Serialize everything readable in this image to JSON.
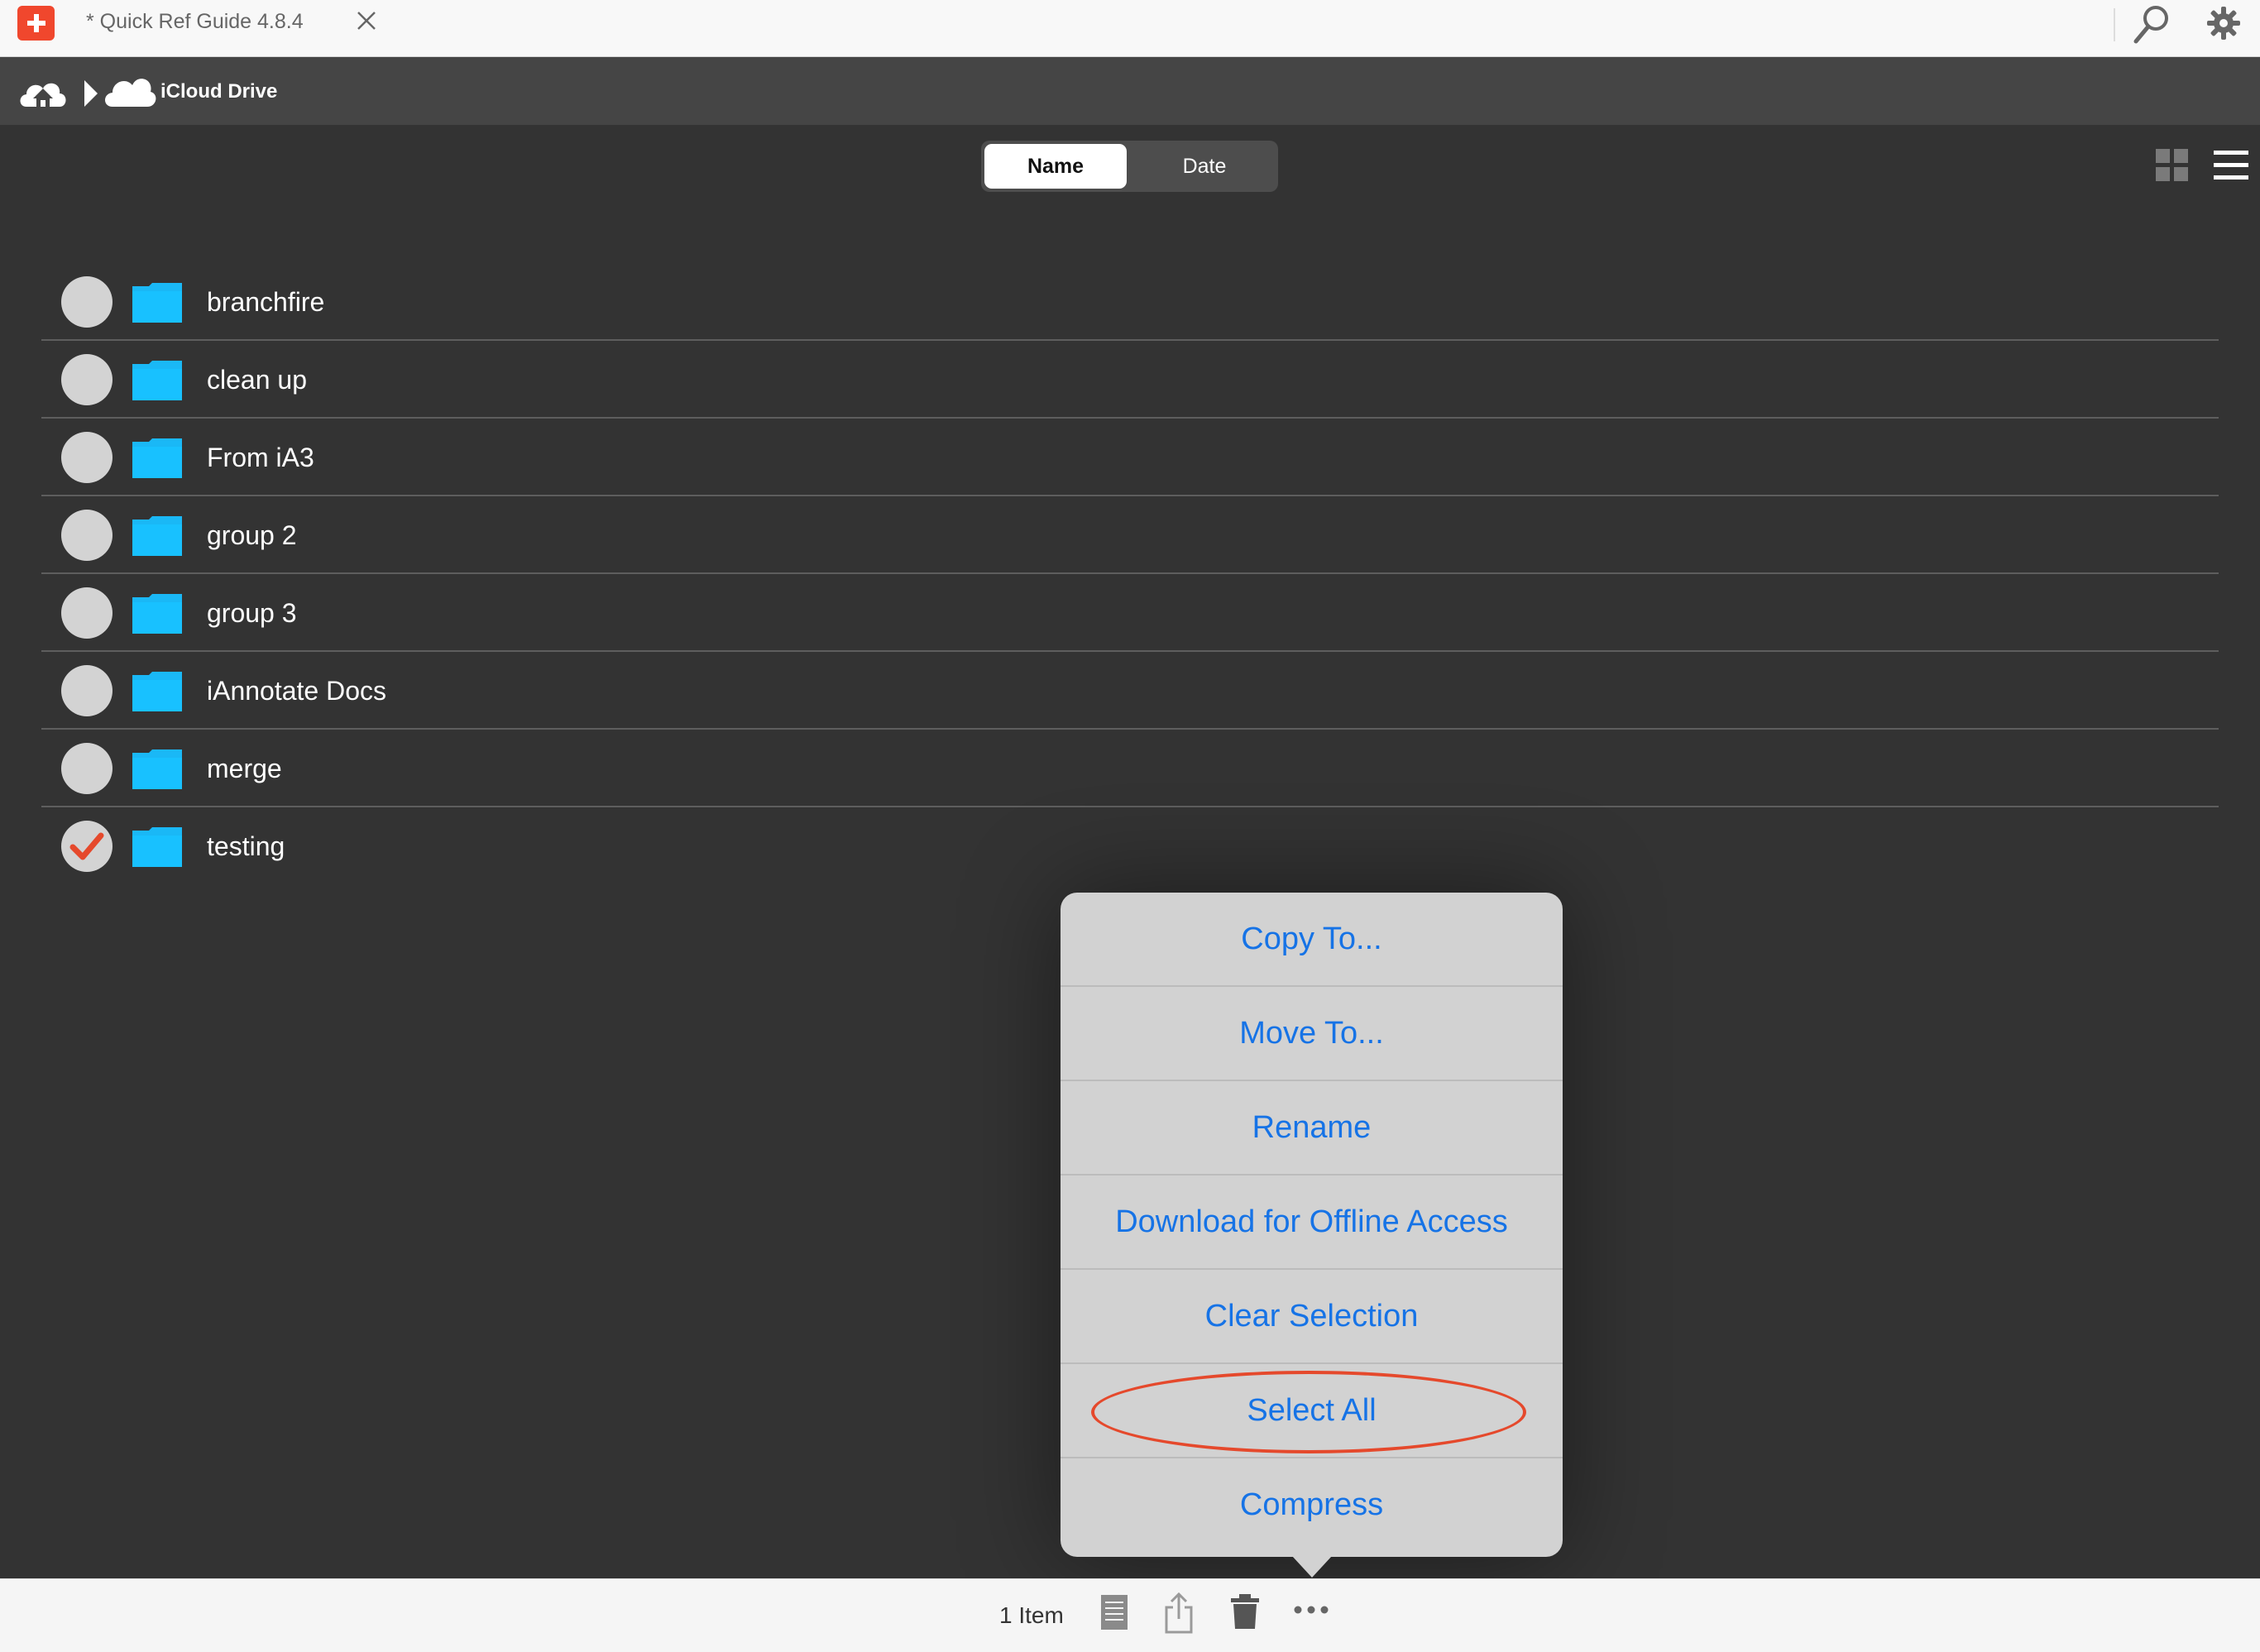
{
  "tab": {
    "title": "* Quick Ref Guide 4.8.4"
  },
  "path": {
    "location": "iCloud Drive"
  },
  "sort": {
    "options": [
      "Name",
      "Date"
    ],
    "selected": "Name"
  },
  "files": [
    {
      "name": "branchfire",
      "selected": false
    },
    {
      "name": "clean up",
      "selected": false
    },
    {
      "name": "From iA3",
      "selected": false
    },
    {
      "name": "group 2",
      "selected": false
    },
    {
      "name": "group 3",
      "selected": false
    },
    {
      "name": "iAnnotate Docs",
      "selected": false
    },
    {
      "name": "merge",
      "selected": false
    },
    {
      "name": "testing",
      "selected": true
    }
  ],
  "menu": {
    "items": [
      "Copy To...",
      "Move To...",
      "Rename",
      "Download for Offline Access",
      "Clear Selection",
      "Select All",
      "Compress"
    ],
    "highlighted": "Select All"
  },
  "toolbar": {
    "count_label": "1 Item"
  },
  "colors": {
    "background": "#333333",
    "accent_blue": "#1673e6",
    "folder_blue": "#1ab8f6",
    "highlight_red": "#e5492c",
    "app_red": "#f0472d"
  },
  "icons": [
    "app-logo-icon",
    "close-icon",
    "search-icon",
    "gear-icon",
    "home-cloud-icon",
    "icloud-icon",
    "grid-view-icon",
    "list-view-icon",
    "folder-icon",
    "check-icon",
    "document-icon",
    "share-icon",
    "trash-icon",
    "more-icon"
  ]
}
